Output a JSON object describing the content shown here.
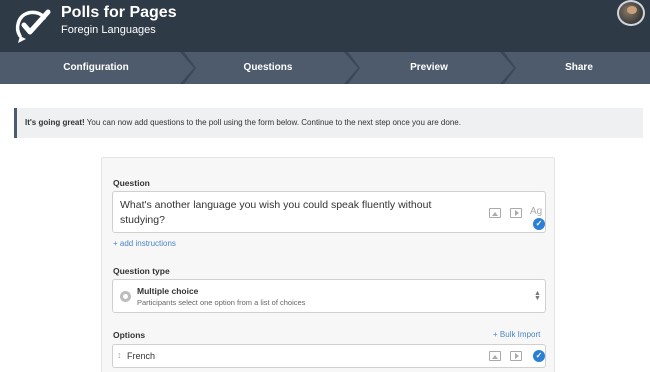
{
  "header": {
    "app_title": "Polls for Pages",
    "subtitle": "Foregin Languages"
  },
  "steps": [
    {
      "label": "Configuration"
    },
    {
      "label": "Questions"
    },
    {
      "label": "Preview"
    },
    {
      "label": "Share"
    }
  ],
  "alert": {
    "strong": "It's going great!",
    "text": " You can now add questions to the poll using the form below. Continue to the next step once you are done."
  },
  "question": {
    "label": "Question",
    "value": "What's another language you wish you could speak fluently without studying?",
    "ag_icon": "Ag",
    "add_instructions": "+ add instructions"
  },
  "question_type": {
    "label": "Question type",
    "title": "Multiple choice",
    "description": "Participants select one option from a list of choices"
  },
  "options": {
    "label": "Options",
    "bulk_import": "+ Bulk Import",
    "items": [
      {
        "text": "French"
      }
    ]
  },
  "colors": {
    "header_bg": "#2f3a47",
    "step_bg": "#4e5b6c",
    "accent": "#2b7fd4",
    "link": "#4a86c5"
  }
}
